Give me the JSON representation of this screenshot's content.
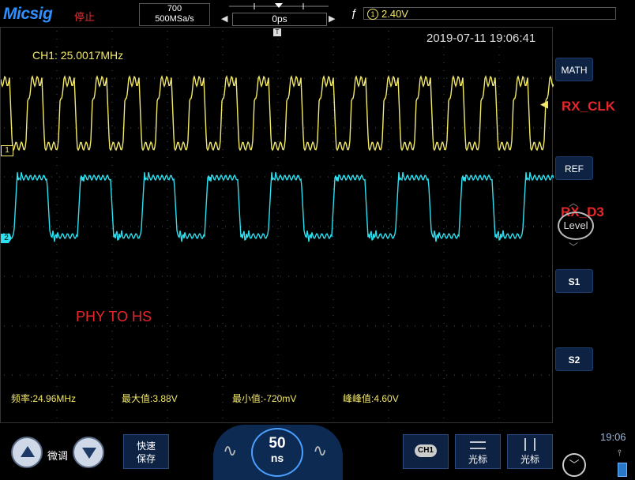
{
  "header": {
    "logo": "Micsig",
    "run_status": "停止",
    "acquisition": {
      "memory": "700",
      "sample_rate": "500MSa/s"
    },
    "horizontal": {
      "position": "0ps",
      "bracket": "[ ]"
    },
    "trigger": {
      "edge_symbol": "ƒ",
      "source": "1",
      "level": "2.40V"
    }
  },
  "screen": {
    "timestamp": "2019-07-11 19:06:41",
    "frequency_readout": "CH1: 25.0017MHz",
    "annotations": {
      "clk": "RX_CLK",
      "d3": "RX_D3",
      "note": "PHY TO HS"
    },
    "channel_markers": {
      "ch1": "1",
      "ch2": "2"
    },
    "trigger_marker": "◀",
    "time_marker": "T",
    "measurements": [
      {
        "label": "频率:24.96MHz"
      },
      {
        "label": "最大值:3.88V"
      },
      {
        "label": "最小值:-720mV"
      },
      {
        "label": "峰峰值:4.60V"
      }
    ],
    "colors": {
      "ch1": "#f2e86a",
      "ch2": "#2de0f0",
      "annotation": "#e8262b"
    }
  },
  "sidebar": {
    "math": "MATH",
    "ref": "REF",
    "level": "Level",
    "s1": "S1",
    "s2": "S2",
    "up_chevron": "︿",
    "down_chevron": "﹀"
  },
  "footer": {
    "fine_label": "微调",
    "quick_save": {
      "line1": "快速",
      "line2": "保存"
    },
    "timebase": {
      "value": "50",
      "unit": "ns"
    },
    "ch1_badge": "CH1",
    "cursor1": "光标",
    "cursor2": "光标",
    "clock": "19:06",
    "chevron": "﹀"
  }
}
